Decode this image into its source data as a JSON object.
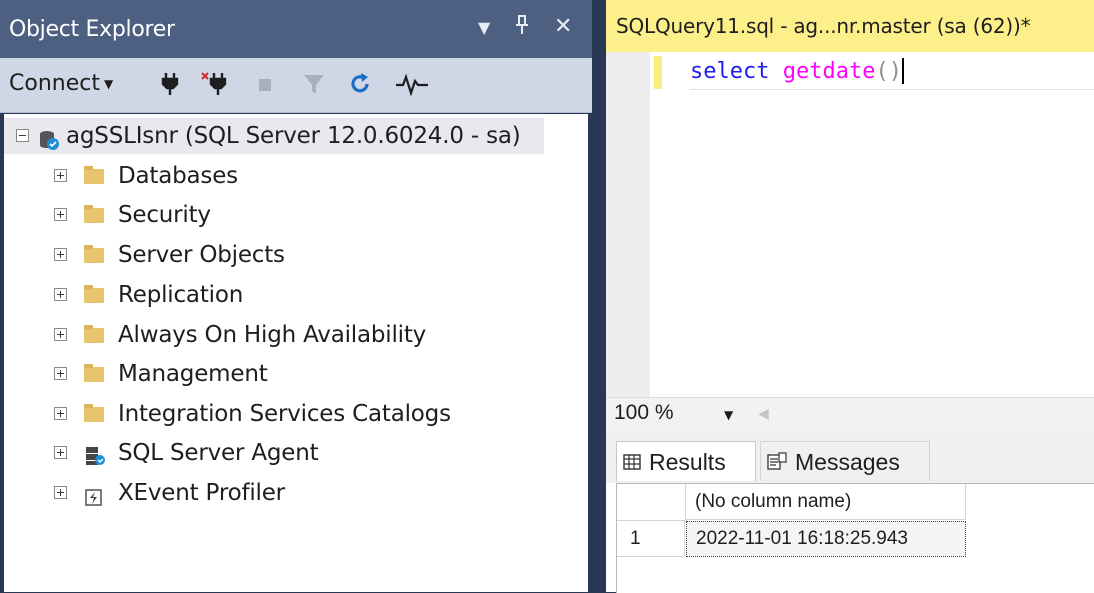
{
  "object_explorer": {
    "title": "Object Explorer",
    "title_controls": [
      "▾",
      "📌",
      "✕"
    ],
    "toolbar": {
      "connect_label": "Connect",
      "connect_dropdown": "▾",
      "icons": [
        "connect-icon",
        "disconnect-icon",
        "stop-icon",
        "filter-icon",
        "refresh-icon",
        "activity-monitor-icon"
      ]
    },
    "tree": {
      "root_label": "agSSLIsnr (SQL Server 12.0.6024.0 - sa)",
      "children": [
        {
          "label": "Databases",
          "icon": "folder-icon"
        },
        {
          "label": "Security",
          "icon": "folder-icon"
        },
        {
          "label": "Server Objects",
          "icon": "folder-icon"
        },
        {
          "label": "Replication",
          "icon": "folder-icon"
        },
        {
          "label": "Always On High Availability",
          "icon": "folder-icon"
        },
        {
          "label": "Management",
          "icon": "folder-icon"
        },
        {
          "label": "Integration Services Catalogs",
          "icon": "folder-icon"
        },
        {
          "label": "SQL Server Agent",
          "icon": "agent-icon"
        },
        {
          "label": "XEvent Profiler",
          "icon": "xevent-icon"
        }
      ]
    }
  },
  "editor": {
    "tab_title": "SQLQuery11.sql - ag...nr.master (sa (62))*",
    "code": {
      "keyword": "select",
      "function": "getdate",
      "parens": "()"
    },
    "zoom": "100 %",
    "colors": {
      "tab_bg": "#fdf08a",
      "keyword": "#1d1ded",
      "function": "#ff00ff"
    }
  },
  "results": {
    "tabs": [
      "Results",
      "Messages"
    ],
    "column_header": "(No column name)",
    "rows": [
      {
        "num": "1",
        "value": "2022-11-01 16:18:25.943"
      }
    ]
  }
}
